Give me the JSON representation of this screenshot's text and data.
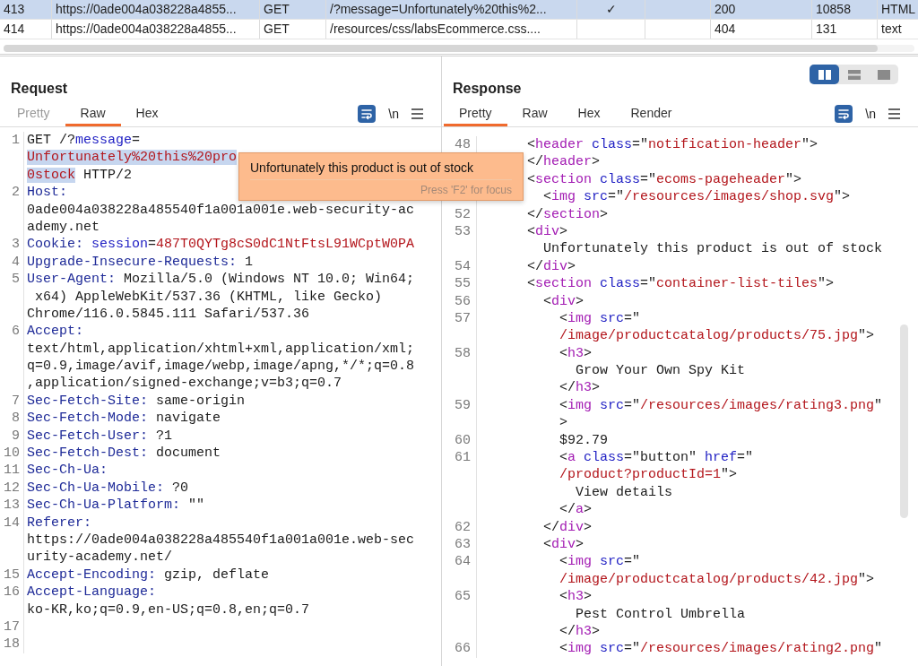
{
  "table": {
    "rows": [
      {
        "selected": true,
        "number": "413",
        "host": "https://0ade004a038228a4855...",
        "method": "GET",
        "path": "/?message=Unfortunately%20this%2...",
        "edited": "✓",
        "status": "200",
        "length": "10858",
        "type": "HTML"
      },
      {
        "selected": false,
        "number": "414",
        "host": "https://0ade004a038228a4855...",
        "method": "GET",
        "path": "/resources/css/labsEcommerce.css....",
        "status": "404",
        "length": "131",
        "type": "text"
      }
    ]
  },
  "request": {
    "title": "Request",
    "tabs": [
      {
        "label": "Pretty",
        "selected": false,
        "disabled": true
      },
      {
        "label": "Raw",
        "selected": true,
        "disabled": false
      },
      {
        "label": "Hex",
        "selected": false,
        "disabled": false
      }
    ],
    "tools": {
      "wrap_on": true,
      "newline_label": "\\n"
    },
    "lines": [
      {
        "number": "1",
        "segments": [
          {
            "text": "GET /?",
            "kind": "plain"
          },
          {
            "text": "message",
            "kind": "attr"
          },
          {
            "text": "=",
            "kind": "plain"
          }
        ]
      },
      {
        "segments": [
          {
            "text": "Unfortunately%20this%20pro",
            "kind": "value",
            "highlighted": true
          }
        ]
      },
      {
        "segments": [
          {
            "text": "0stock",
            "kind": "value",
            "highlighted": true
          },
          {
            "text": " HTTP/2",
            "kind": "plain"
          }
        ]
      },
      {
        "number": "2",
        "segments": [
          {
            "text": "Host:",
            "kind": "key"
          }
        ]
      },
      {
        "segments": [
          {
            "text": "0ade004a038228a485540f1a001a001e.web-security-ac",
            "kind": "plain"
          }
        ]
      },
      {
        "segments": [
          {
            "text": "ademy.net",
            "kind": "plain"
          }
        ]
      },
      {
        "number": "3",
        "segments": [
          {
            "text": "Cookie: ",
            "kind": "key"
          },
          {
            "text": "session",
            "kind": "attr"
          },
          {
            "text": "=",
            "kind": "plain"
          },
          {
            "text": "487T0QYTg8cS0dC1NtFtsL91WCptW0PA",
            "kind": "value"
          }
        ]
      },
      {
        "number": "4",
        "segments": [
          {
            "text": "Upgrade-Insecure-Requests:",
            "kind": "key"
          },
          {
            "text": " 1",
            "kind": "plain"
          }
        ]
      },
      {
        "number": "5",
        "segments": [
          {
            "text": "User-Agent:",
            "kind": "key"
          },
          {
            "text": " Mozilla/5.0 (Windows NT 10.0; Win64;",
            "kind": "plain"
          }
        ]
      },
      {
        "segments": [
          {
            "text": " x64) AppleWebKit/537.36 (KHTML, like Gecko)",
            "kind": "plain"
          }
        ]
      },
      {
        "segments": [
          {
            "text": "Chrome/116.0.5845.111 Safari/537.36",
            "kind": "plain"
          }
        ]
      },
      {
        "number": "6",
        "segments": [
          {
            "text": "Accept:",
            "kind": "key"
          }
        ]
      },
      {
        "segments": [
          {
            "text": "text/html,application/xhtml+xml,application/xml;",
            "kind": "plain"
          }
        ]
      },
      {
        "segments": [
          {
            "text": "q=0.9,image/avif,image/webp,image/apng,*/*;q=0.8",
            "kind": "plain"
          }
        ]
      },
      {
        "segments": [
          {
            "text": ",application/signed-exchange;v=b3;q=0.7",
            "kind": "plain"
          }
        ]
      },
      {
        "number": "7",
        "segments": [
          {
            "text": "Sec-Fetch-Site:",
            "kind": "key"
          },
          {
            "text": " same-origin",
            "kind": "plain"
          }
        ]
      },
      {
        "number": "8",
        "segments": [
          {
            "text": "Sec-Fetch-Mode:",
            "kind": "key"
          },
          {
            "text": " navigate",
            "kind": "plain"
          }
        ]
      },
      {
        "number": "9",
        "segments": [
          {
            "text": "Sec-Fetch-User:",
            "kind": "key"
          },
          {
            "text": " ?1",
            "kind": "plain"
          }
        ]
      },
      {
        "number": "10",
        "segments": [
          {
            "text": "Sec-Fetch-Dest:",
            "kind": "key"
          },
          {
            "text": " document",
            "kind": "plain"
          }
        ]
      },
      {
        "number": "11",
        "segments": [
          {
            "text": "Sec-Ch-Ua:",
            "kind": "key"
          }
        ]
      },
      {
        "number": "12",
        "segments": [
          {
            "text": "Sec-Ch-Ua-Mobile:",
            "kind": "key"
          },
          {
            "text": " ?0",
            "kind": "plain"
          }
        ]
      },
      {
        "number": "13",
        "segments": [
          {
            "text": "Sec-Ch-Ua-Platform:",
            "kind": "key"
          },
          {
            "text": " \"\"",
            "kind": "plain"
          }
        ]
      },
      {
        "number": "14",
        "segments": [
          {
            "text": "Referer:",
            "kind": "key"
          }
        ]
      },
      {
        "segments": [
          {
            "text": "https://0ade004a038228a485540f1a001a001e.web-sec",
            "kind": "plain"
          }
        ]
      },
      {
        "segments": [
          {
            "text": "urity-academy.net/",
            "kind": "plain"
          }
        ]
      },
      {
        "number": "15",
        "segments": [
          {
            "text": "Accept-Encoding:",
            "kind": "key"
          },
          {
            "text": " gzip, deflate",
            "kind": "plain"
          }
        ]
      },
      {
        "number": "16",
        "segments": [
          {
            "text": "Accept-Language:",
            "kind": "key"
          }
        ]
      },
      {
        "segments": [
          {
            "text": "ko-KR,ko;q=0.9,en-US;q=0.8,en;q=0.7",
            "kind": "plain"
          }
        ]
      },
      {
        "number": "17"
      },
      {
        "number": "18"
      }
    ]
  },
  "response": {
    "title": "Response",
    "layout_options": [
      {
        "selected": true
      },
      {
        "selected": false
      },
      {
        "selected": false
      }
    ],
    "tabs": [
      {
        "label": "Pretty",
        "selected": true,
        "disabled": false
      },
      {
        "label": "Raw",
        "selected": false,
        "disabled": false
      },
      {
        "label": "Hex",
        "selected": false,
        "disabled": false
      },
      {
        "label": "Render",
        "selected": false,
        "disabled": false
      }
    ],
    "tools": {
      "wrap_on": true,
      "newline_label": "\\n"
    },
    "lines": [
      {
        "number": "48",
        "segments": [
          {
            "text": "    <",
            "kind": "plain"
          },
          {
            "text": "header",
            "kind": "tag"
          },
          {
            "text": " class",
            "kind": "attr"
          },
          {
            "text": "=\"",
            "kind": "plain"
          },
          {
            "text": "notification-header",
            "kind": "value"
          },
          {
            "text": "\">",
            "kind": "plain"
          }
        ]
      },
      {
        "segments": [
          {
            "text": "    </",
            "kind": "plain"
          },
          {
            "text": "header",
            "kind": "tag"
          },
          {
            "text": ">",
            "kind": "plain"
          }
        ]
      },
      {
        "segments": [
          {
            "text": "    <",
            "kind": "plain"
          },
          {
            "text": "section",
            "kind": "tag"
          },
          {
            "text": " class",
            "kind": "attr"
          },
          {
            "text": "=\"",
            "kind": "plain"
          },
          {
            "text": "ecoms-pageheader",
            "kind": "value"
          },
          {
            "text": "\">",
            "kind": "plain"
          }
        ]
      },
      {
        "segments": [
          {
            "text": "      <",
            "kind": "plain"
          },
          {
            "text": "img",
            "kind": "tag"
          },
          {
            "text": " src",
            "kind": "attr"
          },
          {
            "text": "=\"",
            "kind": "plain"
          },
          {
            "text": "/resources/images/shop.svg",
            "kind": "value"
          },
          {
            "text": "\">",
            "kind": "plain"
          }
        ]
      },
      {
        "number": "52",
        "segments": [
          {
            "text": "    </",
            "kind": "plain"
          },
          {
            "text": "section",
            "kind": "tag"
          },
          {
            "text": ">",
            "kind": "plain"
          }
        ]
      },
      {
        "number": "53",
        "segments": [
          {
            "text": "    <",
            "kind": "plain"
          },
          {
            "text": "div",
            "kind": "tag"
          },
          {
            "text": ">",
            "kind": "plain"
          }
        ]
      },
      {
        "segments": [
          {
            "text": "      Unfortunately this product is out of stock",
            "kind": "plain"
          }
        ]
      },
      {
        "number": "54",
        "segments": [
          {
            "text": "    </",
            "kind": "plain"
          },
          {
            "text": "div",
            "kind": "tag"
          },
          {
            "text": ">",
            "kind": "plain"
          }
        ]
      },
      {
        "number": "55",
        "segments": [
          {
            "text": "    <",
            "kind": "plain"
          },
          {
            "text": "section",
            "kind": "tag"
          },
          {
            "text": " class",
            "kind": "attr"
          },
          {
            "text": "=\"",
            "kind": "plain"
          },
          {
            "text": "container-list-tiles",
            "kind": "value"
          },
          {
            "text": "\">",
            "kind": "plain"
          }
        ]
      },
      {
        "number": "56",
        "segments": [
          {
            "text": "      <",
            "kind": "plain"
          },
          {
            "text": "div",
            "kind": "tag"
          },
          {
            "text": ">",
            "kind": "plain"
          }
        ]
      },
      {
        "number": "57",
        "segments": [
          {
            "text": "        <",
            "kind": "plain"
          },
          {
            "text": "img",
            "kind": "tag"
          },
          {
            "text": " src",
            "kind": "attr"
          },
          {
            "text": "=\"",
            "kind": "plain"
          }
        ]
      },
      {
        "segments": [
          {
            "text": "        /image/productcatalog/products/75.jpg",
            "kind": "value"
          },
          {
            "text": "\">",
            "kind": "plain"
          }
        ]
      },
      {
        "number": "58",
        "segments": [
          {
            "text": "        <",
            "kind": "plain"
          },
          {
            "text": "h3",
            "kind": "tag"
          },
          {
            "text": ">",
            "kind": "plain"
          }
        ]
      },
      {
        "segments": [
          {
            "text": "          Grow Your Own Spy Kit",
            "kind": "plain"
          }
        ]
      },
      {
        "segments": [
          {
            "text": "        </",
            "kind": "plain"
          },
          {
            "text": "h3",
            "kind": "tag"
          },
          {
            "text": ">",
            "kind": "plain"
          }
        ]
      },
      {
        "number": "59",
        "segments": [
          {
            "text": "        <",
            "kind": "plain"
          },
          {
            "text": "img",
            "kind": "tag"
          },
          {
            "text": " src",
            "kind": "attr"
          },
          {
            "text": "=\"",
            "kind": "plain"
          },
          {
            "text": "/resources/images/rating3.png",
            "kind": "value"
          },
          {
            "text": "\"",
            "kind": "plain"
          }
        ]
      },
      {
        "segments": [
          {
            "text": "        >",
            "kind": "plain"
          }
        ]
      },
      {
        "number": "60",
        "segments": [
          {
            "text": "        $92.79",
            "kind": "plain"
          }
        ]
      },
      {
        "number": "61",
        "segments": [
          {
            "text": "        <",
            "kind": "plain"
          },
          {
            "text": "a",
            "kind": "tag"
          },
          {
            "text": " class",
            "kind": "attr"
          },
          {
            "text": "=\"button\"",
            "kind": "plain"
          },
          {
            "text": " href",
            "kind": "attr"
          },
          {
            "text": "=\"",
            "kind": "plain"
          }
        ]
      },
      {
        "segments": [
          {
            "text": "        /product?productId=1",
            "kind": "value"
          },
          {
            "text": "\">",
            "kind": "plain"
          }
        ]
      },
      {
        "segments": [
          {
            "text": "          View details",
            "kind": "plain"
          }
        ]
      },
      {
        "segments": [
          {
            "text": "        </",
            "kind": "plain"
          },
          {
            "text": "a",
            "kind": "tag"
          },
          {
            "text": ">",
            "kind": "plain"
          }
        ]
      },
      {
        "number": "62",
        "segments": [
          {
            "text": "      </",
            "kind": "plain"
          },
          {
            "text": "div",
            "kind": "tag"
          },
          {
            "text": ">",
            "kind": "plain"
          }
        ]
      },
      {
        "number": "63",
        "segments": [
          {
            "text": "      <",
            "kind": "plain"
          },
          {
            "text": "div",
            "kind": "tag"
          },
          {
            "text": ">",
            "kind": "plain"
          }
        ]
      },
      {
        "number": "64",
        "segments": [
          {
            "text": "        <",
            "kind": "plain"
          },
          {
            "text": "img",
            "kind": "tag"
          },
          {
            "text": " src",
            "kind": "attr"
          },
          {
            "text": "=\"",
            "kind": "plain"
          }
        ]
      },
      {
        "segments": [
          {
            "text": "        /image/productcatalog/products/42.jpg",
            "kind": "value"
          },
          {
            "text": "\">",
            "kind": "plain"
          }
        ]
      },
      {
        "number": "65",
        "segments": [
          {
            "text": "        <",
            "kind": "plain"
          },
          {
            "text": "h3",
            "kind": "tag"
          },
          {
            "text": ">",
            "kind": "plain"
          }
        ]
      },
      {
        "segments": [
          {
            "text": "          Pest Control Umbrella",
            "kind": "plain"
          }
        ]
      },
      {
        "segments": [
          {
            "text": "        </",
            "kind": "plain"
          },
          {
            "text": "h3",
            "kind": "tag"
          },
          {
            "text": ">",
            "kind": "plain"
          }
        ]
      },
      {
        "number": "66",
        "segments": [
          {
            "text": "        <",
            "kind": "plain"
          },
          {
            "text": "img",
            "kind": "tag"
          },
          {
            "text": " src",
            "kind": "attr"
          },
          {
            "text": "=\"",
            "kind": "plain"
          },
          {
            "text": "/resources/images/rating2.png",
            "kind": "value"
          },
          {
            "text": "\"",
            "kind": "plain"
          }
        ]
      }
    ]
  },
  "tooltip": {
    "message": "Unfortunately this product is out of stock",
    "hint": "Press 'F2' for focus"
  }
}
